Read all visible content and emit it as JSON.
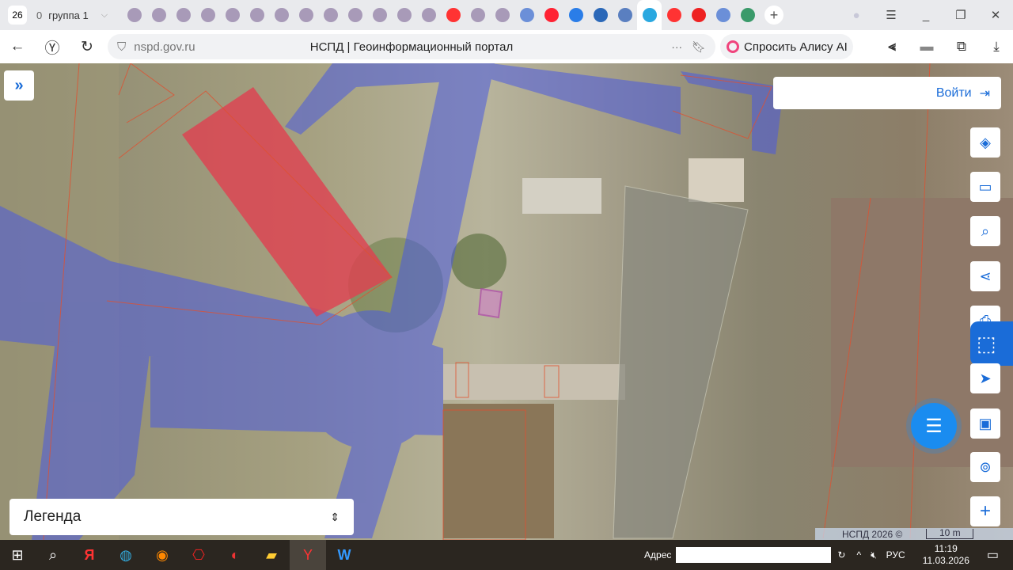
{
  "browser": {
    "tab_count": "26",
    "group": {
      "count": "0",
      "name": "группа 1"
    },
    "favicons": [
      "tab",
      "tab",
      "tab",
      "tab",
      "tab",
      "tab",
      "tab",
      "tab",
      "tab",
      "tab",
      "tab",
      "tab",
      "tab",
      "yandex",
      "tab",
      "tab",
      "gerb",
      "maps",
      "mail",
      "gosuslugi-case",
      "fns",
      "nspd-active",
      "yandex",
      "heart",
      "gerb",
      "green"
    ],
    "url_host": "nspd.gov.ru",
    "page_title": "НСПД | Геоинформационный портал",
    "alice_label": "Спросить Алису AI"
  },
  "map": {
    "login_label": "Войти",
    "legend_label": "Легенда",
    "copyright": "НСПД 2026 ©",
    "scale_label": "10 m",
    "colors": {
      "accent": "#1a6cd8",
      "road_overlay": "#4a5ae0",
      "building": "#e04050",
      "parcel_border": "#e05030"
    }
  },
  "taskbar": {
    "address_label": "Адрес",
    "address_value": "",
    "language": "РУС",
    "time": "11:19",
    "date": "11.03.2026"
  }
}
